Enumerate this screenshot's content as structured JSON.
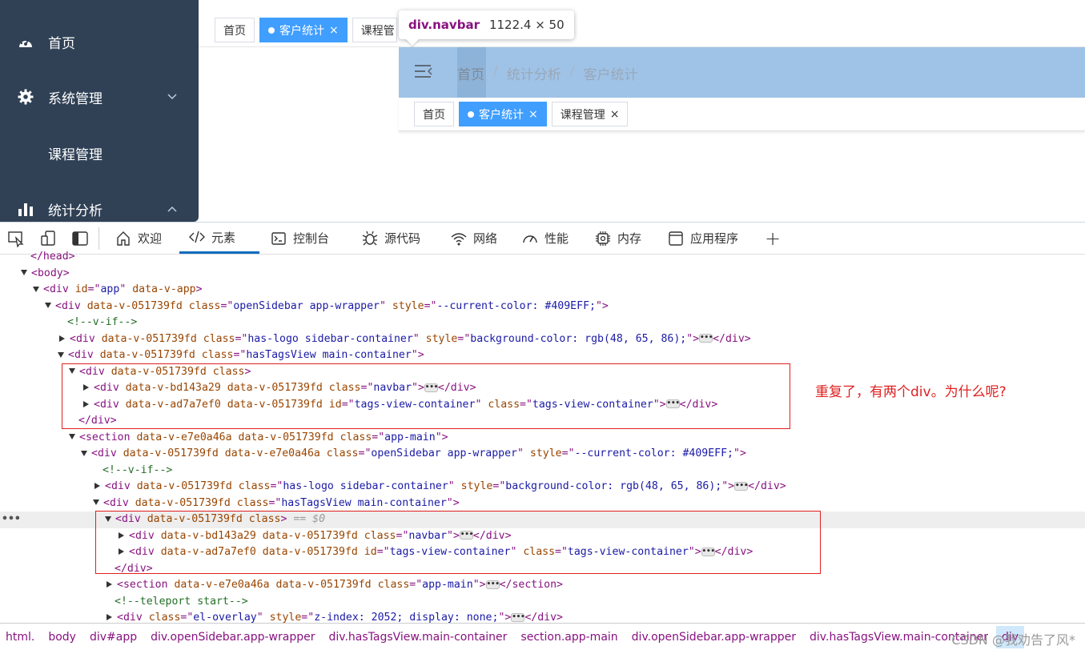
{
  "sidebar": {
    "bg": "#304156",
    "items": [
      {
        "label": "首页",
        "icon": "dashboard-icon"
      },
      {
        "label": "系统管理",
        "icon": "gear-icon"
      },
      {
        "label": "课程管理",
        "icon": ""
      },
      {
        "label": "统计分析",
        "icon": "bar-chart-icon"
      }
    ]
  },
  "tags": {
    "home": "首页",
    "customer": "客户统计",
    "course_partial": "课程管",
    "course": "课程管理",
    "close": "×",
    "active_color": "#409EFF"
  },
  "navbar": {
    "breadcrumb": [
      "首页",
      "统计分析",
      "客户统计"
    ],
    "sep": "/"
  },
  "tooltip": {
    "name": "div.navbar",
    "size": "1122.4 × 50"
  },
  "devtools": {
    "tabs": [
      {
        "label": "欢迎",
        "icon": "home-icon"
      },
      {
        "label": "元素",
        "icon": "code-icon"
      },
      {
        "label": "控制台",
        "icon": "console-icon"
      },
      {
        "label": "源代码",
        "icon": "bug-icon"
      },
      {
        "label": "网络",
        "icon": "wifi-icon"
      },
      {
        "label": "性能",
        "icon": "gauge-icon"
      },
      {
        "label": "内存",
        "icon": "chip-icon"
      },
      {
        "label": "应用程序",
        "icon": "app-icon"
      }
    ],
    "add_tab": "+",
    "dom": {
      "head_close": "</head>",
      "body_open": "<body>",
      "app_div": [
        "<div ",
        "id",
        "=\"",
        "app",
        "\" ",
        "data-v-app",
        ">"
      ],
      "sel_marker": "== $0",
      "comment_vif": "<!--v-if-->",
      "comment_teleport": "<!--teleport start-->"
    },
    "annotation": "重复了，有两个div。为什么呢?",
    "breadcrumbs": [
      "html.",
      "body",
      "div#app",
      "div.openSidebar.app-wrapper",
      "div.hasTagsView.main-container",
      "section.app-main",
      "div.openSidebar.app-wrapper",
      "div.hasTagsView.main-container",
      "div"
    ]
  },
  "watermark": "CSDN @我劝告了风*"
}
